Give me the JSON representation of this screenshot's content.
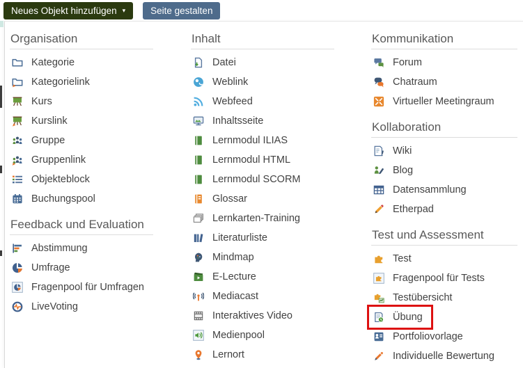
{
  "toolbar": {
    "add_object_label": "Neues Objekt hinzufügen",
    "caret": "▾",
    "design_page_label": "Seite gestalten"
  },
  "colors": {
    "add_button_bg": "#2b3a10",
    "design_button_bg": "#4e6b8b",
    "section_header_text": "#595959",
    "item_text": "#424242",
    "highlight_border": "#dd1111"
  },
  "annotation": {
    "type": "highlight-box",
    "target": "Übung"
  },
  "menu": {
    "columns": [
      {
        "sections": [
          {
            "title": "Organisation",
            "items": [
              {
                "label": "Kategorie",
                "icon": "category-folder-icon"
              },
              {
                "label": "Kategorielink",
                "icon": "category-link-icon"
              },
              {
                "label": "Kurs",
                "icon": "course-icon"
              },
              {
                "label": "Kurslink",
                "icon": "course-link-icon"
              },
              {
                "label": "Gruppe",
                "icon": "group-icon"
              },
              {
                "label": "Gruppenlink",
                "icon": "group-link-icon"
              },
              {
                "label": "Objekteblock",
                "icon": "item-group-icon"
              },
              {
                "label": "Buchungspool",
                "icon": "booking-pool-icon"
              }
            ]
          },
          {
            "title": "Feedback und Evaluation",
            "items": [
              {
                "label": "Abstimmung",
                "icon": "poll-icon"
              },
              {
                "label": "Umfrage",
                "icon": "survey-icon"
              },
              {
                "label": "Fragenpool für Umfragen",
                "icon": "survey-question-pool-icon"
              },
              {
                "label": "LiveVoting",
                "icon": "live-voting-icon"
              }
            ]
          }
        ]
      },
      {
        "sections": [
          {
            "title": "Inhalt",
            "items": [
              {
                "label": "Datei",
                "icon": "file-icon"
              },
              {
                "label": "Weblink",
                "icon": "weblink-globe-icon"
              },
              {
                "label": "Webfeed",
                "icon": "webfeed-rss-icon"
              },
              {
                "label": "Inhaltsseite",
                "icon": "content-page-icon"
              },
              {
                "label": "Lernmodul ILIAS",
                "icon": "learning-module-icon"
              },
              {
                "label": "Lernmodul HTML",
                "icon": "learning-module-icon"
              },
              {
                "label": "Lernmodul SCORM",
                "icon": "learning-module-icon"
              },
              {
                "label": "Glossar",
                "icon": "glossary-icon"
              },
              {
                "label": "Lernkarten-Training",
                "icon": "flashcard-training-icon"
              },
              {
                "label": "Literaturliste",
                "icon": "bibliography-icon"
              },
              {
                "label": "Mindmap",
                "icon": "mindmap-icon"
              },
              {
                "label": "E-Lecture",
                "icon": "e-lecture-icon"
              },
              {
                "label": "Mediacast",
                "icon": "mediacast-icon"
              },
              {
                "label": "Interaktives Video",
                "icon": "interactive-video-icon"
              },
              {
                "label": "Medienpool",
                "icon": "media-pool-icon"
              },
              {
                "label": "Lernort",
                "icon": "location-pin-icon"
              }
            ]
          }
        ]
      },
      {
        "sections": [
          {
            "title": "Kommunikation",
            "items": [
              {
                "label": "Forum",
                "icon": "forum-icon"
              },
              {
                "label": "Chatraum",
                "icon": "chat-icon"
              },
              {
                "label": "Virtueller Meetingraum",
                "icon": "virtual-meeting-icon"
              }
            ]
          },
          {
            "title": "Kollaboration",
            "items": [
              {
                "label": "Wiki",
                "icon": "wiki-icon"
              },
              {
                "label": "Blog",
                "icon": "blog-icon"
              },
              {
                "label": "Datensammlung",
                "icon": "data-collection-icon"
              },
              {
                "label": "Etherpad",
                "icon": "etherpad-pencil-icon"
              }
            ]
          },
          {
            "title": "Test und Assessment",
            "items": [
              {
                "label": "Test",
                "icon": "test-puzzle-icon"
              },
              {
                "label": "Fragenpool für Tests",
                "icon": "test-question-pool-icon"
              },
              {
                "label": "Testübersicht",
                "icon": "test-overview-icon"
              },
              {
                "label": "Übung",
                "icon": "exercise-icon",
                "highlighted": true
              },
              {
                "label": "Portfoliovorlage",
                "icon": "portfolio-template-icon"
              },
              {
                "label": "Individuelle Bewertung",
                "icon": "individual-assessment-icon"
              }
            ]
          }
        ]
      }
    ]
  }
}
